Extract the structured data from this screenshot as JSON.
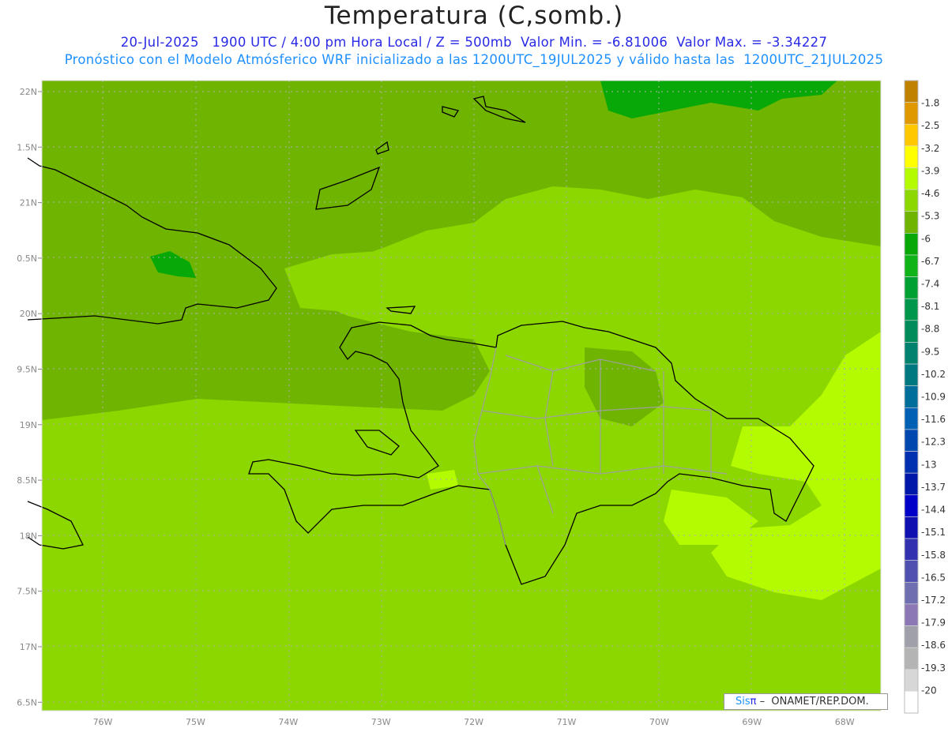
{
  "header": {
    "title": "Temperatura (C,somb.)",
    "date": "20-Jul-2025",
    "time": "1900 UTC / 4:00 pm Hora Local / Z = 500mb",
    "min_label": "Valor Min. = -6.81006",
    "max_label": "Valor Max. = -3.34227",
    "subtitle": "Pronóstico con el Modelo Atmósferico WRF inicializado a las 1200UTC_19JUL2025 y válido hasta las  1200UTC_21JUL2025"
  },
  "axes": {
    "lon_labels": [
      "76W",
      "75W",
      "74W",
      "73W",
      "72W",
      "71W",
      "70W",
      "69W",
      "68W"
    ],
    "lat_labels": [
      "22N",
      "1.5N",
      "21N",
      "0.5N",
      "20N",
      "9.5N",
      "19N",
      "8.5N",
      "18N",
      "7.5N",
      "17N",
      "6.5N"
    ]
  },
  "colorbar": {
    "labels": [
      "-1.8",
      "-2.5",
      "-3.2",
      "-3.9",
      "-4.6",
      "-5.3",
      "-6",
      "-6.7",
      "-7.4",
      "-8.1",
      "-8.8",
      "-9.5",
      "-10.2",
      "-10.9",
      "-11.6",
      "-12.3",
      "-13",
      "-13.7",
      "-14.4",
      "-15.1",
      "-15.8",
      "-16.5",
      "-17.2",
      "-17.9",
      "-18.6",
      "-19.3",
      "-20"
    ],
    "colors": [
      "#c08000",
      "#e09800",
      "#ffc800",
      "#ffff00",
      "#b4fa00",
      "#8cd700",
      "#6eb400",
      "#08a808",
      "#10b418",
      "#00a032",
      "#00964b",
      "#008c5a",
      "#00826e",
      "#007880",
      "#006e9a",
      "#0060b4",
      "#0048b0",
      "#0030b0",
      "#0018aa",
      "#0000c8",
      "#1010b0",
      "#3232b0",
      "#5050b0",
      "#6e6eb0",
      "#8c78b4",
      "#a0a0aa",
      "#b4b4b4",
      "#d7d7d7",
      "#ffffff"
    ]
  },
  "field_colors": {
    "base": "#8cd700",
    "dark": "#6eb400",
    "light": "#b4fa00",
    "deep": "#08a808"
  },
  "credit": {
    "sis": "Sis",
    "pi": "π",
    "rest": " –  ONAMET/REP.DOM."
  }
}
